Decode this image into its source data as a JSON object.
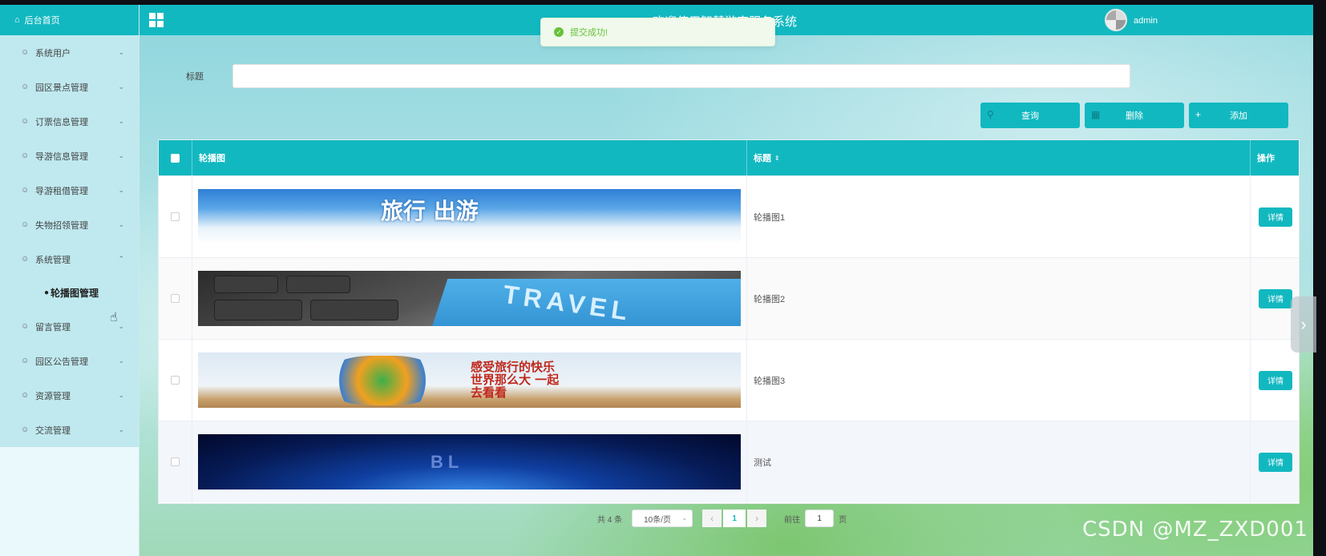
{
  "sidebar": {
    "home_label": "后台首页",
    "items": [
      {
        "label": "系统用户",
        "expanded": false
      },
      {
        "label": "园区景点管理",
        "expanded": false
      },
      {
        "label": "订票信息管理",
        "expanded": false
      },
      {
        "label": "导游信息管理",
        "expanded": false
      },
      {
        "label": "导游租借管理",
        "expanded": false
      },
      {
        "label": "失物招领管理",
        "expanded": false
      },
      {
        "label": "系统管理",
        "expanded": true
      },
      {
        "label": "留言管理",
        "expanded": false
      },
      {
        "label": "园区公告管理",
        "expanded": false
      },
      {
        "label": "资源管理",
        "expanded": false
      },
      {
        "label": "交流管理",
        "expanded": false
      }
    ],
    "submenu_active": "轮播图管理"
  },
  "header": {
    "title": "欢迎使用智慧游客服务系统",
    "username": "admin"
  },
  "toast": {
    "message": "提交成功!",
    "color": "#67c23a"
  },
  "search": {
    "label": "标题",
    "value": "",
    "placeholder": ""
  },
  "toolbar": {
    "query_label": "查询",
    "delete_label": "删除",
    "add_label": "添加"
  },
  "table": {
    "columns": [
      "轮播图",
      "标题",
      "操作"
    ],
    "rows": [
      {
        "title": "轮播图1",
        "banner_text": "旅行  出游",
        "action": "详情"
      },
      {
        "title": "轮播图2",
        "banner_text": "TRAVEL",
        "action": "详情"
      },
      {
        "title": "轮播图3",
        "banner_text": "感受旅行的快乐 世界那么大 一起去看看",
        "action": "详情"
      },
      {
        "title": "测试",
        "banner_text": "BL",
        "action": "详情"
      }
    ]
  },
  "pager": {
    "total": "共 4 条",
    "page_size": "10条/页",
    "current_page": "1",
    "goto_label": "前往",
    "goto_value": "1",
    "page_suffix": "页"
  },
  "watermark": "CSDN @MZ_ZXD001",
  "colors": {
    "accent": "#12b8c0",
    "sidebar_bg": "#bfe9ef",
    "success": "#67c23a"
  }
}
